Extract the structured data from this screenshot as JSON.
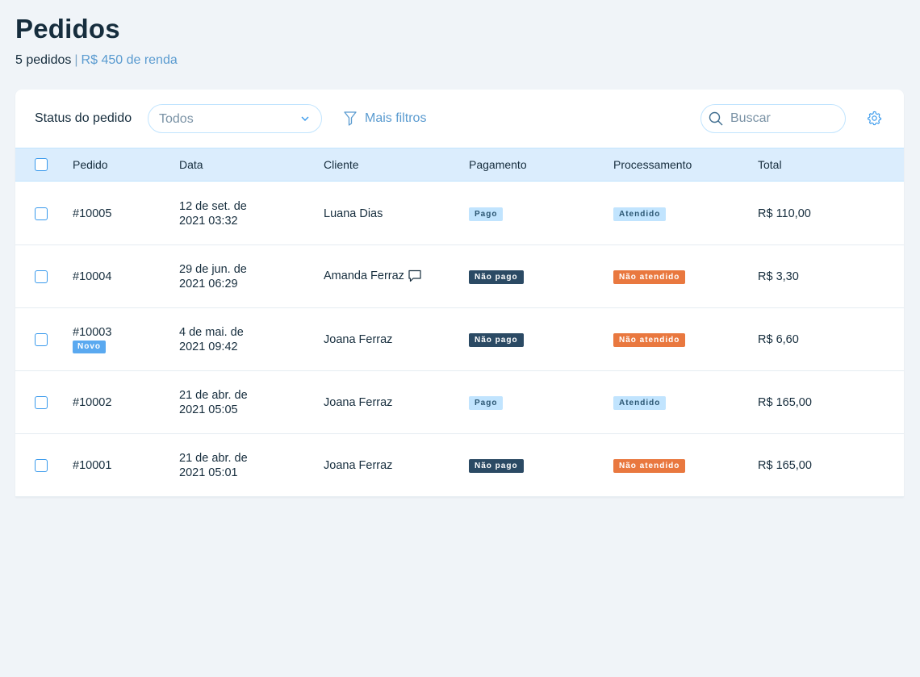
{
  "header": {
    "title": "Pedidos",
    "order_count": "5 pedidos",
    "separator": "|",
    "income": "R$ 450 de renda"
  },
  "toolbar": {
    "status_label": "Status do pedido",
    "status_value": "Todos",
    "more_filters": "Mais filtros",
    "search_placeholder": "Buscar"
  },
  "table": {
    "columns": [
      "Pedido",
      "Data",
      "Cliente",
      "Pagamento",
      "Processamento",
      "Total"
    ],
    "rows": [
      {
        "order": "#10005",
        "date_line1": "12 de set. de",
        "date_line2": "2021 03:32",
        "client": "Luana Dias",
        "payment": "Pago",
        "processing": "Atendido",
        "total": "R$ 110,00"
      },
      {
        "order": "#10004",
        "date_line1": "29 de jun. de",
        "date_line2": "2021 06:29",
        "client": "Amanda Ferraz",
        "payment": "Não pago",
        "processing": "Não atendido",
        "total": "R$ 3,30"
      },
      {
        "order": "#10003",
        "badge": "Novo",
        "date_line1": "4 de mai. de",
        "date_line2": "2021 09:42",
        "client": "Joana Ferraz",
        "payment": "Não pago",
        "processing": "Não atendido",
        "total": "R$ 6,60"
      },
      {
        "order": "#10002",
        "date_line1": "21 de abr. de",
        "date_line2": "2021 05:05",
        "client": "Joana Ferraz",
        "payment": "Pago",
        "processing": "Atendido",
        "total": "R$ 165,00"
      },
      {
        "order": "#10001",
        "date_line1": "21 de abr. de",
        "date_line2": "2021 05:01",
        "client": "Joana Ferraz",
        "payment": "Não pago",
        "processing": "Não atendido",
        "total": "R$ 165,00"
      }
    ]
  },
  "icons": {
    "dropdown": "chevron-down-icon",
    "filter": "filter-icon",
    "search": "search-icon",
    "settings": "gear-icon",
    "note": "chat-bubble-icon"
  },
  "colors": {
    "background": "#f0f4f8",
    "accent": "#3899ec",
    "header_row": "#dbedfd",
    "paid_badge": "#c1e4fe",
    "unpaid_badge": "#2b4a64",
    "unfulfilled_badge": "#e9783f",
    "new_badge": "#5aa9f0"
  }
}
